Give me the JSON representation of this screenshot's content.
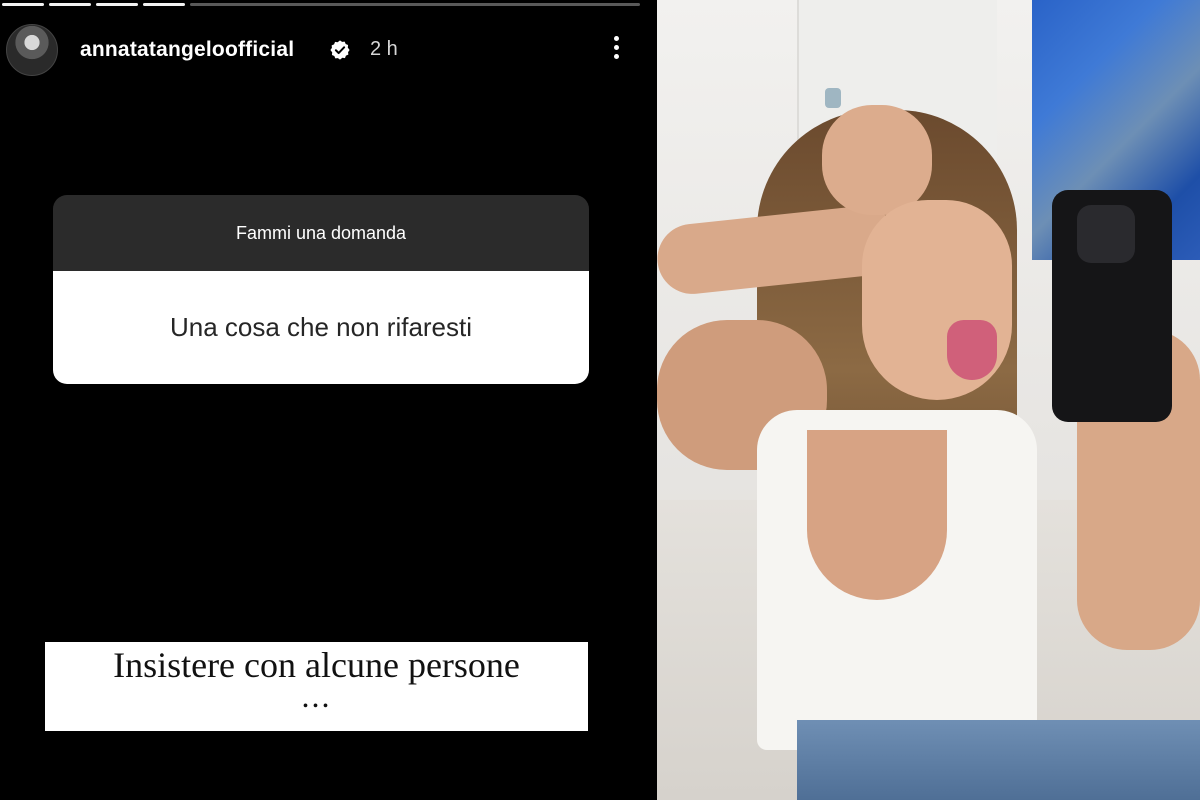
{
  "story": {
    "username": "annatatangeloofficial",
    "time": "2 h",
    "question_sticker": {
      "header": "Fammi una domanda",
      "question": "Una cosa che non rifaresti"
    },
    "answer": {
      "line1": "Insistere con alcune persone",
      "line2": "..."
    }
  },
  "icons": {
    "verified": "verified-badge-icon",
    "more": "more-vertical-icon"
  }
}
